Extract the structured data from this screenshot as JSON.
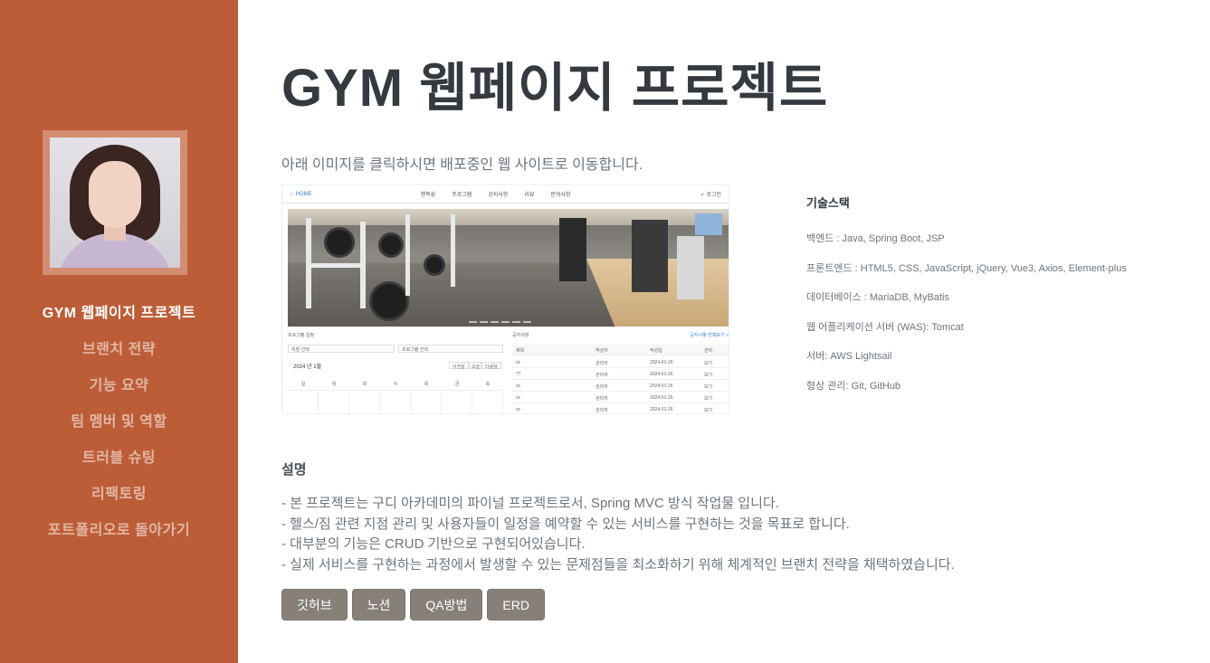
{
  "sidebar": {
    "profile_alt": "profile photo",
    "items": [
      {
        "label": "GYM 웹페이지 프로젝트",
        "active": true
      },
      {
        "label": "브랜치 전략"
      },
      {
        "label": "기능 요약"
      },
      {
        "label": "팀 멤버 및 역할"
      },
      {
        "label": "트러블 슈팅"
      },
      {
        "label": "리팩토링"
      },
      {
        "label": "포트폴리오로 돌아가기"
      }
    ]
  },
  "main": {
    "title": "GYM 웹페이지 프로젝트",
    "intro": "아래 이미지를 클릭하시면 배포중인 웹 사이트로 이동합니다.",
    "screenshot": {
      "nav_home": "HOME",
      "nav_items": [
        "행복쉼",
        "프로그램",
        "공지사항",
        "리뷰",
        "문의사항"
      ],
      "nav_login": "로그인",
      "left_title": "프로그램 일정",
      "left_select1": "지점 선택",
      "left_select2": "프로그램 선택",
      "month": "2024 년 1월",
      "month_buttons": [
        "이전달",
        "오늘",
        "다음달"
      ],
      "weekdays": [
        "일",
        "월",
        "화",
        "수",
        "목",
        "금",
        "토"
      ],
      "right_title": "공지사항",
      "right_more": "공지사항 전체보기 >",
      "table_headers": [
        "제목",
        "작성자",
        "작성일",
        "관리"
      ],
      "table_rows": [
        [
          "zz",
          "관리자",
          "2024-01-26",
          "보기"
        ],
        [
          "??",
          "관리자",
          "2024-01-26",
          "보기"
        ],
        [
          "zz",
          "관리자",
          "2024-01-26",
          "보기"
        ],
        [
          "zz",
          "관리자",
          "2024-01-26",
          "보기"
        ],
        [
          "zz",
          "관리자",
          "2024-01-26",
          "보기"
        ]
      ]
    },
    "tech": {
      "heading": "기술스택",
      "lines": [
        "백엔드 : Java, Spring Boot, JSP",
        "프론트엔드 : HTML5, CSS, JavaScript, jQuery, Vue3, Axios, Element-plus",
        "데이터베이스 : MariaDB, MyBatis",
        "웹 어플리케이션 서버 (WAS): Tomcat",
        "서버: AWS Lightsail",
        "형상 관리: Git, GitHub"
      ]
    },
    "description": {
      "heading": "설명",
      "lines": [
        "- 본 프로젝트는 구디 아카데미의 파이널 프로젝트로서, Spring MVC 방식 작업물 입니다.",
        "- 헬스/짐 관련 지점 관리 및 사용자들이 일정을 예약할 수 있는 서비스를 구현하는 것을 목표로 합니다.",
        "- 대부분의 기능은 CRUD 기반으로 구현되어있습니다.",
        "- 실제 서비스를 구현하는 과정에서 발생할 수 있는 문제점들을 최소화하기 위해 체계적인 브랜치 전략을 채택하였습니다."
      ]
    },
    "buttons": [
      "깃허브",
      "노션",
      "QA방법",
      "ERD"
    ]
  },
  "colors": {
    "sidebar": "#bd5d38",
    "button": "#868079",
    "title": "#343a40",
    "text": "#6c757d"
  }
}
